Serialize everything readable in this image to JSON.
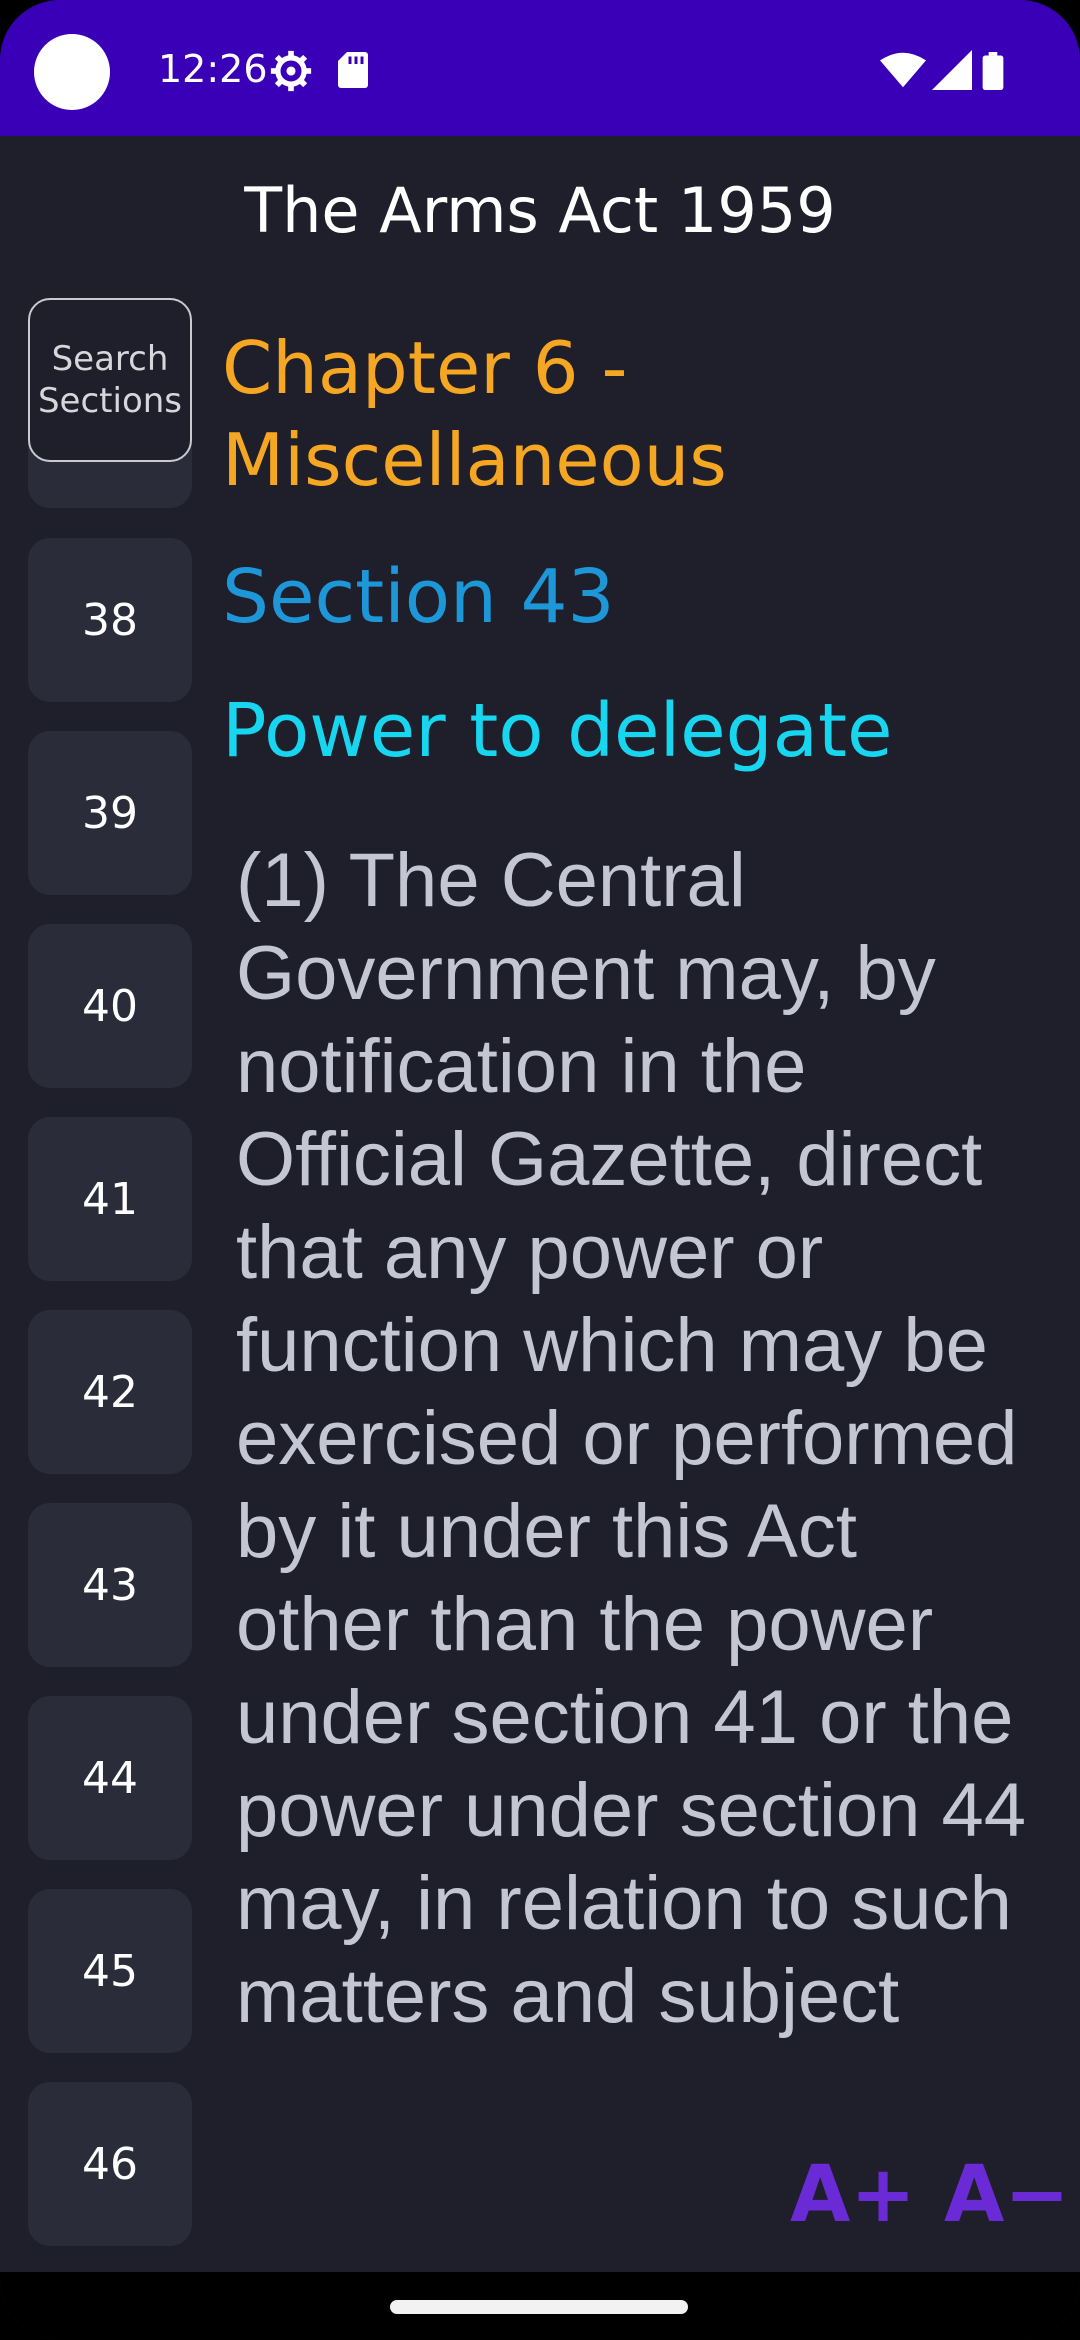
{
  "status_bar": {
    "time": "12:26",
    "icons": [
      "gear-icon",
      "sd-card-icon",
      "wifi-icon",
      "signal-icon",
      "battery-icon"
    ],
    "background_color": "#3a00b8"
  },
  "header": {
    "title": "The Arms Act 1959"
  },
  "sidebar": {
    "search_label_line1": "Search",
    "search_label_line2": "Sections",
    "sections": [
      "38",
      "39",
      "40",
      "41",
      "42",
      "43",
      "44",
      "45",
      "46"
    ]
  },
  "content": {
    "chapter": "Chapter 6 - Miscellaneous",
    "section_number": "Section 43",
    "section_title": "Power to delegate",
    "body_text": "(1) The Central Government may, by notification in the Official Gazette, direct that any power or function which may be exercised or performed by it under this Act other than the power under section 41 or the power under section 44 may, in relation to such matters and subject"
  },
  "font_controls": {
    "increase_label": "A+",
    "decrease_label": "A−"
  },
  "colors": {
    "background": "#1e1f2a",
    "chapter": "#f5a623",
    "section_number": "#1e97d9",
    "section_title": "#18d6f0",
    "body": "#c4c6d4",
    "font_buttons": "#6a2bd6"
  }
}
